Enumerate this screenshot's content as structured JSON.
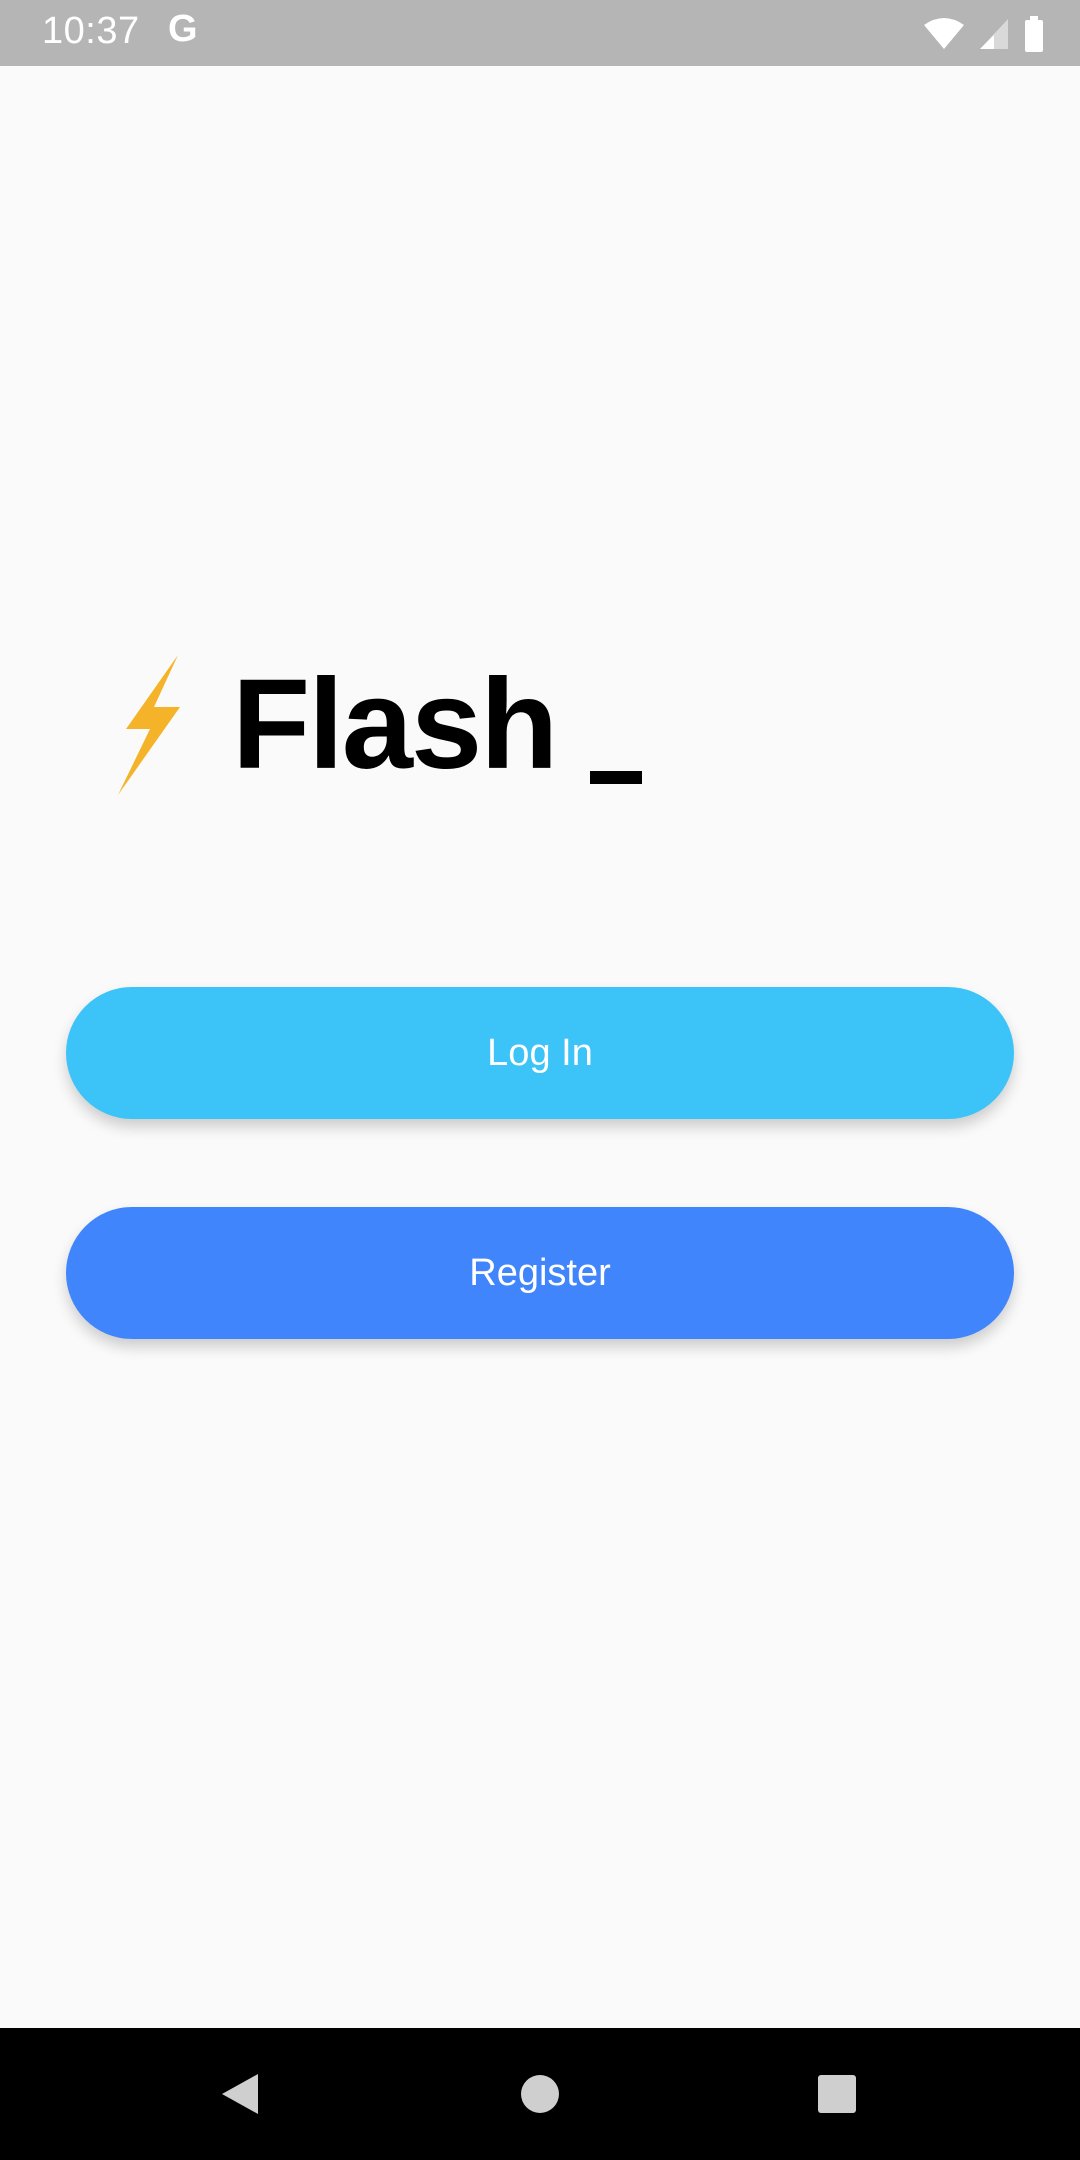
{
  "status_bar": {
    "time": "10:37",
    "notification_glyph": "G",
    "icons": [
      "wifi-icon",
      "cellular-signal-icon",
      "battery-icon"
    ]
  },
  "app": {
    "title": "Flash",
    "logo_icon": "lightning-bolt-icon",
    "cursor_glyph": "_"
  },
  "buttons": {
    "login_label": "Log In",
    "register_label": "Register"
  },
  "nav_bar": {
    "icons": [
      "back-icon",
      "home-icon",
      "recents-icon"
    ]
  },
  "colors": {
    "status_bar_bg": "#b5b5b5",
    "background": "#fafafa",
    "login_button": "#3cc3f8",
    "register_button": "#4185fc",
    "bolt": "#f5b32a",
    "nav_bar_bg": "#000000"
  }
}
